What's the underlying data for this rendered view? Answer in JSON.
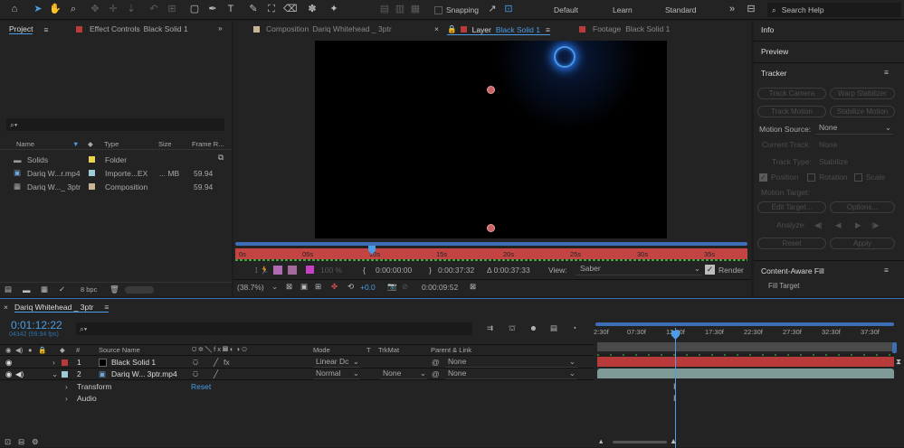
{
  "toolbar": {
    "snapping": "Snapping",
    "workspaces": [
      "Default",
      "Learn",
      "Standard"
    ],
    "search_placeholder": "Search Help"
  },
  "project_panel": {
    "tab_project": "Project",
    "tab_effect_controls": "Effect Controls",
    "effect_controls_layer": "Black Solid 1",
    "search_glyph": "⌕▾",
    "columns": {
      "name": "Name",
      "type": "Type",
      "size": "Size",
      "frame_rate": "Frame R..."
    },
    "items": [
      {
        "name": "Solids",
        "type": "Folder",
        "size": "",
        "fps": "",
        "label_color": "#e8d44d"
      },
      {
        "name": "Dariq W...r.mp4",
        "type": "Importe...EX",
        "size": "... MB",
        "fps": "59.94",
        "label_color": "#9ecbd6"
      },
      {
        "name": "Dariq W..._ 3ptr",
        "type": "Composition",
        "size": "",
        "fps": "59.94",
        "label_color": "#c8b596"
      }
    ],
    "bpc": "8 bpc"
  },
  "viewer": {
    "tab_composition": "Composition",
    "composition_name": "Dariq Whitehead _ 3ptr",
    "tab_layer": "Layer",
    "layer_name": "Black Solid 1",
    "tab_footage": "Footage",
    "footage_name": "Black Solid 1",
    "ruler_ticks": [
      "0s",
      "05s",
      "10s",
      "15s",
      "20s",
      "25s",
      "30s",
      "35s"
    ],
    "zoom_pct": "100 %",
    "in_time": "0:00:00:00",
    "out_time": "0:00:37:32",
    "duration": "Δ 0:00:37:33",
    "view_label": "View:",
    "view_value": "Saber",
    "render_label": "Render",
    "magnification": "(38.7%)",
    "exposure": "+0.0",
    "current_time": "0:00:09:52"
  },
  "right_panels": {
    "info": "Info",
    "preview": "Preview",
    "tracker": "Tracker",
    "track_camera": "Track Camera",
    "warp_stabilizer": "Warp Stabilizer",
    "track_motion": "Track Motion",
    "stabilize_motion": "Stabilize Motion",
    "motion_source_label": "Motion Source:",
    "motion_source_value": "None",
    "current_track_label": "Current Track:",
    "current_track_value": "None",
    "track_type_label": "Track Type:",
    "track_type_value": "Stabilize",
    "position": "Position",
    "rotation": "Rotation",
    "scale": "Scale",
    "motion_target": "Motion Target:",
    "edit_target": "Edit Target...",
    "options": "Options...",
    "analyze": "Analyze:",
    "reset": "Reset",
    "apply": "Apply",
    "content_aware_fill": "Content-Aware Fill",
    "fill_target": "Fill Target"
  },
  "timeline": {
    "tab": "Dariq Whitehead _ 3ptr",
    "timecode": "0:01:12:22",
    "frame_info": "04342 (59.94 fps)",
    "search_glyph": "⌕▾",
    "columns": {
      "num": "#",
      "source_name": "Source Name",
      "mode": "Mode",
      "t": "T",
      "trkmat": "TrkMat",
      "parent": "Parent & Link"
    },
    "layers": [
      {
        "num": "1",
        "name": "Black Solid 1",
        "mode": "Linear Dc",
        "trkmat": "",
        "parent": "None",
        "color": "#b93a3a"
      },
      {
        "num": "2",
        "name": "Dariq W... 3ptr.mp4",
        "mode": "Normal",
        "trkmat": "None",
        "parent": "None",
        "color": "#9ecbd6"
      }
    ],
    "props": {
      "transform": "Transform",
      "reset": "Reset",
      "audio": "Audio"
    },
    "ruler_ticks": [
      "2:30f",
      "07:30f",
      "12:30f",
      "17:30f",
      "22:30f",
      "27:30f",
      "32:30f",
      "37:30f"
    ]
  }
}
